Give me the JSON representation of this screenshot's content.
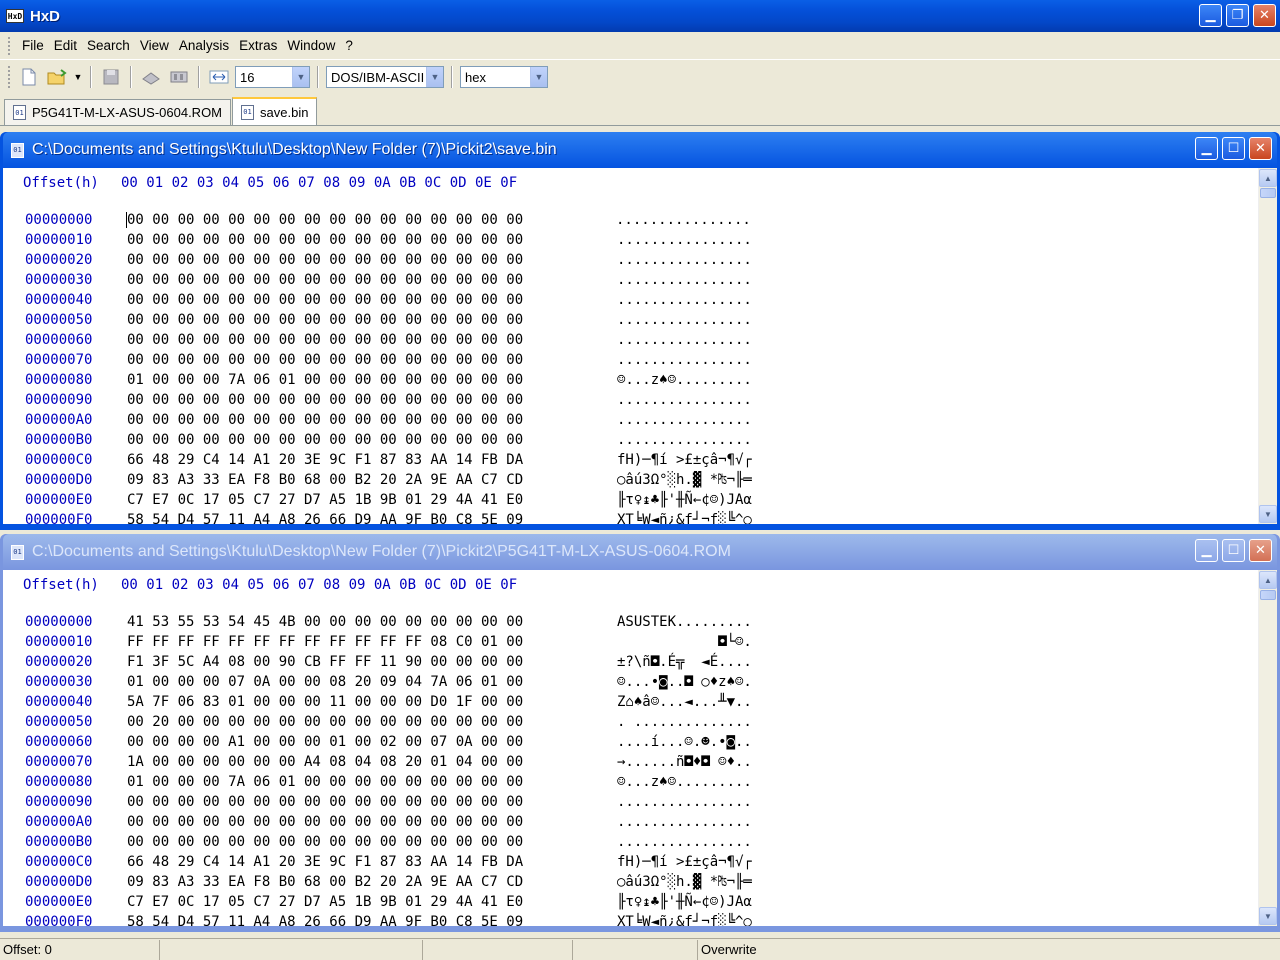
{
  "app": {
    "title": "HxD"
  },
  "menu": [
    "File",
    "Edit",
    "Search",
    "View",
    "Analysis",
    "Extras",
    "Window",
    "?"
  ],
  "toolbar": {
    "bytes_per_row": "16",
    "charset": "DOS/IBM-ASCII",
    "offset_base": "hex"
  },
  "tabs": [
    {
      "label": "P5G41T-M-LX-ASUS-0604.ROM",
      "active": false
    },
    {
      "label": "save.bin",
      "active": true
    }
  ],
  "header": {
    "offset_label": "Offset(h)",
    "columns": "00 01 02 03 04 05 06 07 08 09 0A 0B 0C 0D 0E 0F"
  },
  "windows": [
    {
      "title": "C:\\Documents and Settings\\Ktulu\\Desktop\\New Folder (7)\\Pickit2\\save.bin",
      "active": true,
      "rows": [
        {
          "offset": "00000000",
          "hex": "00 00 00 00 00 00 00 00 00 00 00 00 00 00 00 00",
          "ascii": "................"
        },
        {
          "offset": "00000010",
          "hex": "00 00 00 00 00 00 00 00 00 00 00 00 00 00 00 00",
          "ascii": "................"
        },
        {
          "offset": "00000020",
          "hex": "00 00 00 00 00 00 00 00 00 00 00 00 00 00 00 00",
          "ascii": "................"
        },
        {
          "offset": "00000030",
          "hex": "00 00 00 00 00 00 00 00 00 00 00 00 00 00 00 00",
          "ascii": "................"
        },
        {
          "offset": "00000040",
          "hex": "00 00 00 00 00 00 00 00 00 00 00 00 00 00 00 00",
          "ascii": "................"
        },
        {
          "offset": "00000050",
          "hex": "00 00 00 00 00 00 00 00 00 00 00 00 00 00 00 00",
          "ascii": "................"
        },
        {
          "offset": "00000060",
          "hex": "00 00 00 00 00 00 00 00 00 00 00 00 00 00 00 00",
          "ascii": "................"
        },
        {
          "offset": "00000070",
          "hex": "00 00 00 00 00 00 00 00 00 00 00 00 00 00 00 00",
          "ascii": "................"
        },
        {
          "offset": "00000080",
          "hex": "01 00 00 00 7A 06 01 00 00 00 00 00 00 00 00 00",
          "ascii": "☺...z♠☺........."
        },
        {
          "offset": "00000090",
          "hex": "00 00 00 00 00 00 00 00 00 00 00 00 00 00 00 00",
          "ascii": "................"
        },
        {
          "offset": "000000A0",
          "hex": "00 00 00 00 00 00 00 00 00 00 00 00 00 00 00 00",
          "ascii": "................"
        },
        {
          "offset": "000000B0",
          "hex": "00 00 00 00 00 00 00 00 00 00 00 00 00 00 00 00",
          "ascii": "................"
        },
        {
          "offset": "000000C0",
          "hex": "66 48 29 C4 14 A1 20 3E 9C F1 87 83 AA 14 FB DA",
          "ascii": "fH)─¶í >£±çâ¬¶√┌"
        },
        {
          "offset": "000000D0",
          "hex": "09 83 A3 33 EA F8 B0 68 00 B2 20 2A 9E AA C7 CD",
          "ascii": "○âú3Ω°░h.▓ *₧¬╟═"
        },
        {
          "offset": "000000E0",
          "hex": "C7 E7 0C 17 05 C7 27 D7 A5 1B 9B 01 29 4A 41 E0",
          "ascii": "╟τ♀↨♣╟'╫Ñ←¢☺)JAα"
        },
        {
          "offset": "000000F0",
          "hex": "58 54 D4 57 11 A4 A8 26 66 D9 AA 9F B0 C8 5E 09",
          "ascii": "XT╘W◄ñ¿&f┘¬ƒ░╚^○"
        }
      ]
    },
    {
      "title": "C:\\Documents and Settings\\Ktulu\\Desktop\\New Folder (7)\\Pickit2\\P5G41T-M-LX-ASUS-0604.ROM",
      "active": false,
      "rows": [
        {
          "offset": "00000000",
          "hex": "41 53 55 53 54 45 4B 00 00 00 00 00 00 00 00 00",
          "ascii": "ASUSTEK........."
        },
        {
          "offset": "00000010",
          "hex": "FF FF FF FF FF FF FF FF FF FF FF FF 08 C0 01 00",
          "ascii": "            ◘└☺."
        },
        {
          "offset": "00000020",
          "hex": "F1 3F 5C A4 08 00 90 CB FF FF 11 90 00 00 00 00",
          "ascii": "±?\\ñ◘.É╦  ◄É...."
        },
        {
          "offset": "00000030",
          "hex": "01 00 00 00 07 0A 00 00 08 20 09 04 7A 06 01 00",
          "ascii": "☺...•◙..◘ ○♦z♠☺."
        },
        {
          "offset": "00000040",
          "hex": "5A 7F 06 83 01 00 00 00 11 00 00 00 D0 1F 00 00",
          "ascii": "Z⌂♠â☺...◄...╨▼.."
        },
        {
          "offset": "00000050",
          "hex": "00 20 00 00 00 00 00 00 00 00 00 00 00 00 00 00",
          "ascii": ". .............."
        },
        {
          "offset": "00000060",
          "hex": "00 00 00 00 A1 00 00 00 01 00 02 00 07 0A 00 00",
          "ascii": "....í...☺.☻.•◙.."
        },
        {
          "offset": "00000070",
          "hex": "1A 00 00 00 00 00 00 A4 08 04 08 20 01 04 00 00",
          "ascii": "→......ñ◘♦◘ ☺♦.."
        },
        {
          "offset": "00000080",
          "hex": "01 00 00 00 7A 06 01 00 00 00 00 00 00 00 00 00",
          "ascii": "☺...z♠☺........."
        },
        {
          "offset": "00000090",
          "hex": "00 00 00 00 00 00 00 00 00 00 00 00 00 00 00 00",
          "ascii": "................"
        },
        {
          "offset": "000000A0",
          "hex": "00 00 00 00 00 00 00 00 00 00 00 00 00 00 00 00",
          "ascii": "................"
        },
        {
          "offset": "000000B0",
          "hex": "00 00 00 00 00 00 00 00 00 00 00 00 00 00 00 00",
          "ascii": "................"
        },
        {
          "offset": "000000C0",
          "hex": "66 48 29 C4 14 A1 20 3E 9C F1 87 83 AA 14 FB DA",
          "ascii": "fH)─¶í >£±çâ¬¶√┌"
        },
        {
          "offset": "000000D0",
          "hex": "09 83 A3 33 EA F8 B0 68 00 B2 20 2A 9E AA C7 CD",
          "ascii": "○âú3Ω°░h.▓ *₧¬╟═"
        },
        {
          "offset": "000000E0",
          "hex": "C7 E7 0C 17 05 C7 27 D7 A5 1B 9B 01 29 4A 41 E0",
          "ascii": "╟τ♀↨♣╟'╫Ñ←¢☺)JAα"
        },
        {
          "offset": "000000F0",
          "hex": "58 54 D4 57 11 A4 A8 26 66 D9 AA 9F B0 C8 5E 09",
          "ascii": "XT╘W◄ñ¿&f┘¬ƒ░╚^○"
        }
      ]
    }
  ],
  "status": {
    "offset": "Offset: 0",
    "mode": "Overwrite"
  }
}
